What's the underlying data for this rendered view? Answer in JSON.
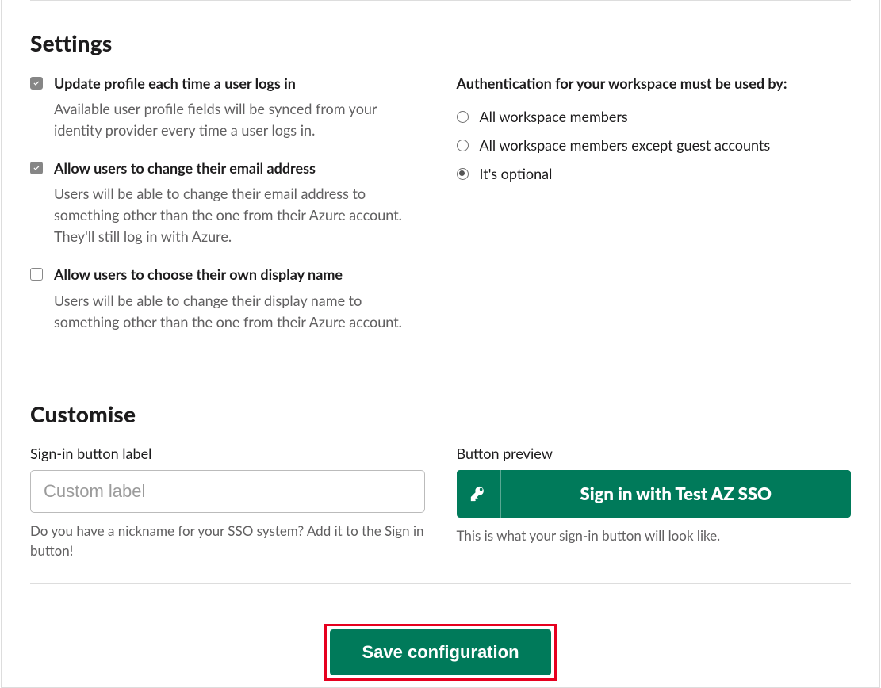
{
  "settings": {
    "heading": "Settings",
    "options": [
      {
        "title": "Update profile each time a user logs in",
        "description": "Available user profile fields will be synced from your identity provider every time a user logs in.",
        "checked": true
      },
      {
        "title": "Allow users to change their email address",
        "description": "Users will be able to change their email address to something other than the one from their Azure account. They'll still log in with Azure.",
        "checked": true
      },
      {
        "title": "Allow users to choose their own display name",
        "description": "Users will be able to change their display name to something other than the one from their Azure account.",
        "checked": false
      }
    ],
    "auth_group": {
      "title": "Authentication for your workspace must be used by:",
      "choices": [
        {
          "label": "All workspace members",
          "selected": false
        },
        {
          "label": "All workspace members except guest accounts",
          "selected": false
        },
        {
          "label": "It's optional",
          "selected": true
        }
      ]
    }
  },
  "customise": {
    "heading": "Customise",
    "signin_label_field": {
      "label": "Sign-in button label",
      "placeholder": "Custom label",
      "value": "",
      "help": "Do you have a nickname for your SSO system? Add it to the Sign in button!"
    },
    "preview": {
      "label": "Button preview",
      "button_text": "Sign in with Test AZ SSO",
      "help": "This is what your sign-in button will look like."
    }
  },
  "actions": {
    "save_label": "Save configuration"
  }
}
